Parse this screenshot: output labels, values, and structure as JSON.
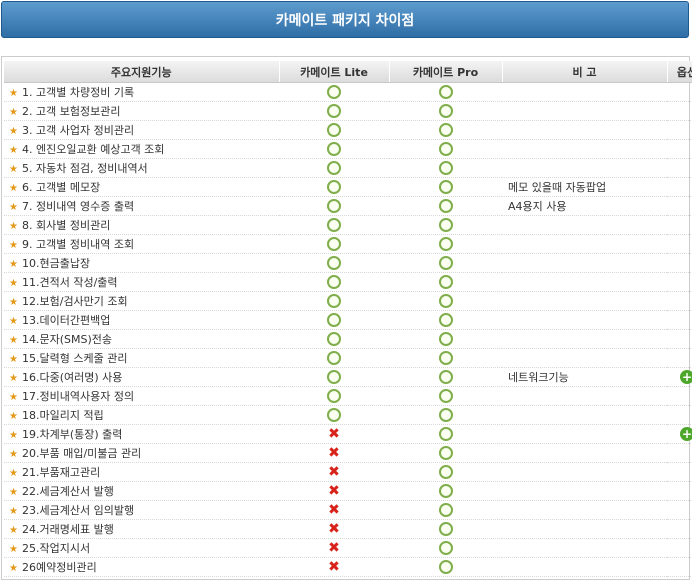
{
  "title": "카메이트 패키지 차이점",
  "headers": [
    "주요지원기능",
    "카메이트 Lite",
    "카메이트 Pro",
    "비  고",
    "옵션"
  ],
  "rows": [
    {
      "feature": "1. 고객별 차량정비 기록",
      "lite": "yes",
      "pro": "yes",
      "note": "",
      "option": ""
    },
    {
      "feature": "2. 고객 보험정보관리",
      "lite": "yes",
      "pro": "yes",
      "note": "",
      "option": ""
    },
    {
      "feature": "3. 고객 사업자 정비관리",
      "lite": "yes",
      "pro": "yes",
      "note": "",
      "option": ""
    },
    {
      "feature": "4. 엔진오일교환 예상고객 조회",
      "lite": "yes",
      "pro": "yes",
      "note": "",
      "option": ""
    },
    {
      "feature": "5. 자동차 점검, 정비내역서",
      "lite": "yes",
      "pro": "yes",
      "note": "",
      "option": ""
    },
    {
      "feature": "6. 고객별 메모장",
      "lite": "yes",
      "pro": "yes",
      "note": "메모 있을때 자동팝업",
      "option": ""
    },
    {
      "feature": "7. 정비내역 영수증 출력",
      "lite": "yes",
      "pro": "yes",
      "note": "A4용지 사용",
      "option": ""
    },
    {
      "feature": "8. 회사별 정비관리",
      "lite": "yes",
      "pro": "yes",
      "note": "",
      "option": ""
    },
    {
      "feature": "9. 고객별 정비내역 조회",
      "lite": "yes",
      "pro": "yes",
      "note": "",
      "option": ""
    },
    {
      "feature": "10.현금출납장",
      "lite": "yes",
      "pro": "yes",
      "note": "",
      "option": ""
    },
    {
      "feature": "11.견적서 작성/출력",
      "lite": "yes",
      "pro": "yes",
      "note": "",
      "option": ""
    },
    {
      "feature": "12.보험/검사만기 조회",
      "lite": "yes",
      "pro": "yes",
      "note": "",
      "option": ""
    },
    {
      "feature": "13.데이터간편백업",
      "lite": "yes",
      "pro": "yes",
      "note": "",
      "option": ""
    },
    {
      "feature": "14.문자(SMS)전송",
      "lite": "yes",
      "pro": "yes",
      "note": "",
      "option": ""
    },
    {
      "feature": "15.달력형 스케줄 관리",
      "lite": "yes",
      "pro": "yes",
      "note": "",
      "option": ""
    },
    {
      "feature": "16.다중(여러명) 사용",
      "lite": "yes",
      "pro": "yes",
      "note": "네트워크기능",
      "option": "plus"
    },
    {
      "feature": "17.정비내역사용자 정의",
      "lite": "yes",
      "pro": "yes",
      "note": "",
      "option": ""
    },
    {
      "feature": "18.마일리지 적립",
      "lite": "yes",
      "pro": "yes",
      "note": "",
      "option": ""
    },
    {
      "feature": "19.차계부(통장) 출력",
      "lite": "no",
      "pro": "yes",
      "note": "",
      "option": "plus"
    },
    {
      "feature": "20.부품 매입/미불금 관리",
      "lite": "no",
      "pro": "yes",
      "note": "",
      "option": ""
    },
    {
      "feature": "21.부품재고관리",
      "lite": "no",
      "pro": "yes",
      "note": "",
      "option": ""
    },
    {
      "feature": "22.세금계산서 발행",
      "lite": "no",
      "pro": "yes",
      "note": "",
      "option": ""
    },
    {
      "feature": "23.세금계산서 임의발행",
      "lite": "no",
      "pro": "yes",
      "note": "",
      "option": ""
    },
    {
      "feature": "24.거래명세표 발행",
      "lite": "no",
      "pro": "yes",
      "note": "",
      "option": ""
    },
    {
      "feature": "25.작업지시서",
      "lite": "no",
      "pro": "yes",
      "note": "",
      "option": ""
    },
    {
      "feature": "26예약정비관리",
      "lite": "no",
      "pro": "yes",
      "note": "",
      "option": ""
    }
  ],
  "icons": {
    "row_marker": "star-icon",
    "yes": "circle-check-icon",
    "no": "x-mark-icon",
    "option": "plus-circle-icon"
  },
  "colors": {
    "title_bg": "#2f6ea6",
    "star": "#e39a1b",
    "yes": "#7fae4a",
    "no": "#d8231a",
    "plus": "#4ca72a"
  }
}
